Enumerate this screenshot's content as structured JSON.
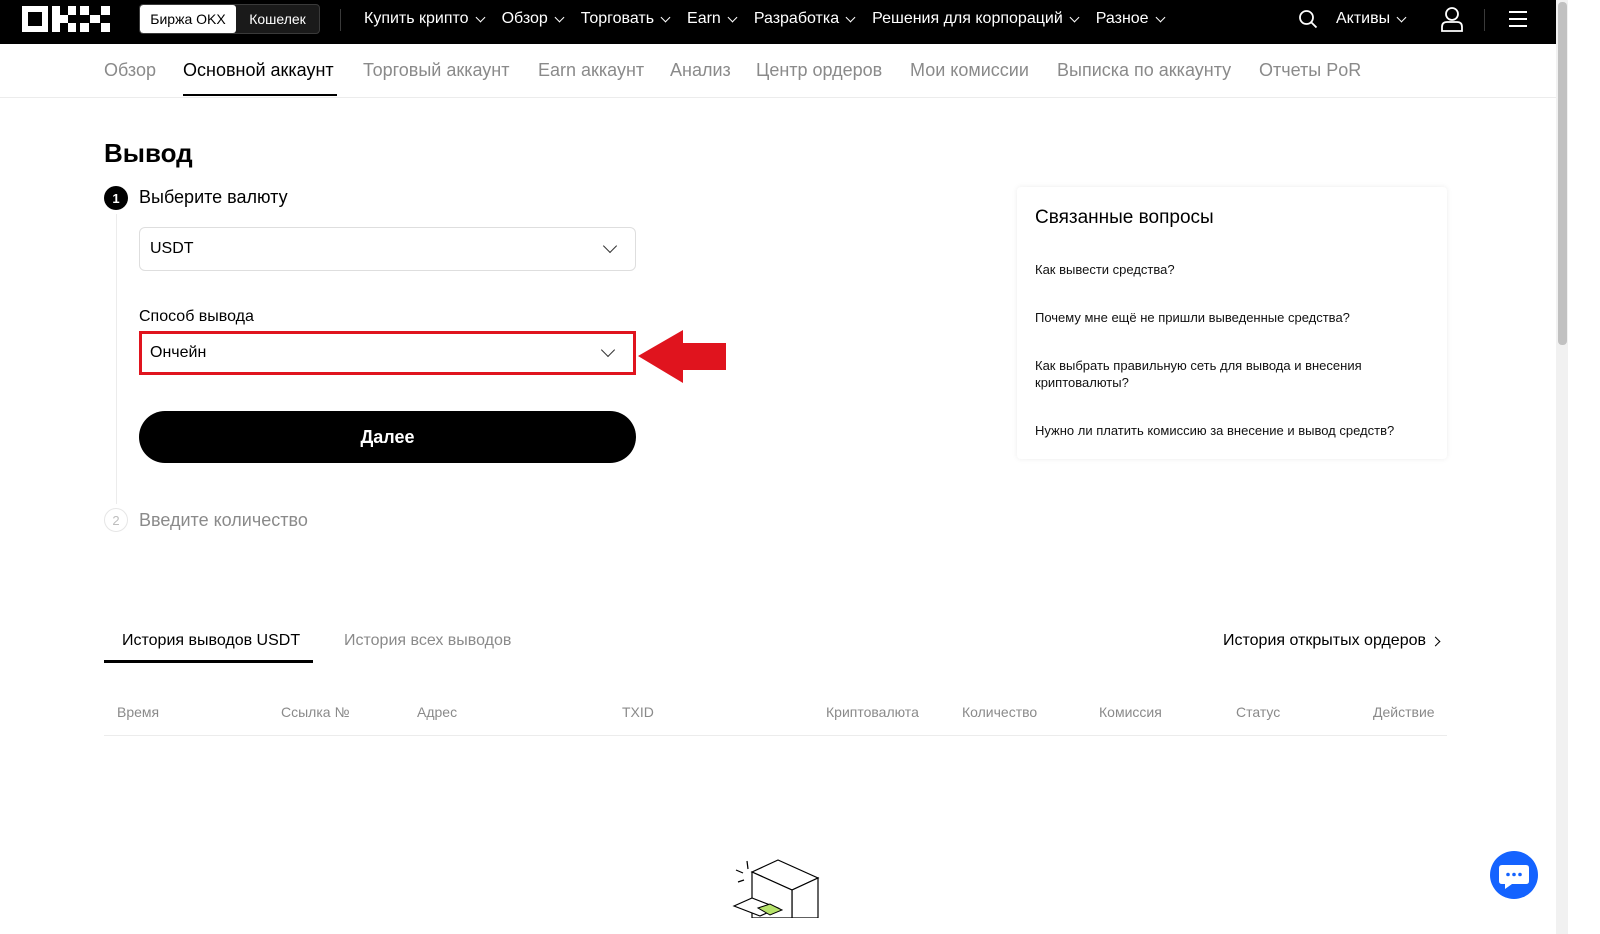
{
  "header": {
    "switch": {
      "exchange_label": "Биржа OKX",
      "wallet_label": "Кошелек"
    },
    "nav": [
      {
        "label": "Купить крипто"
      },
      {
        "label": "Обзор"
      },
      {
        "label": "Торговать"
      },
      {
        "label": "Earn"
      },
      {
        "label": "Разработка"
      },
      {
        "label": "Решения для корпораций"
      },
      {
        "label": "Разное"
      }
    ],
    "assets_label": "Активы"
  },
  "subnav": {
    "items": [
      {
        "label": "Обзор"
      },
      {
        "label": "Основной аккаунт"
      },
      {
        "label": "Торговый аккаунт"
      },
      {
        "label": "Earn аккаунт"
      },
      {
        "label": "Анализ"
      },
      {
        "label": "Центр ордеров"
      },
      {
        "label": "Мои комиссии"
      },
      {
        "label": "Выписка по аккаунту"
      },
      {
        "label": "Отчеты PoR"
      }
    ]
  },
  "withdraw": {
    "title": "Вывод",
    "step1": {
      "number": "1",
      "label": "Выберите валюту"
    },
    "currency_value": "USDT",
    "method_label": "Способ вывода",
    "method_value": "Ончейн",
    "next_label": "Далее",
    "step2": {
      "number": "2",
      "label": "Введите количество"
    }
  },
  "faq": {
    "title": "Связанные вопросы",
    "items": [
      "Как вывести средства?",
      "Почему мне ещё не пришли выведенные средства?",
      "Как выбрать правильную сеть для вывода и внесения криптовалюты?",
      "Нужно ли платить комиссию за внесение и вывод средств?"
    ]
  },
  "history": {
    "tab_active": "История выводов USDT",
    "tab_all": "История всех выводов",
    "open_orders_label": "История открытых ордеров",
    "columns": [
      "Время",
      "Ссылка №",
      "Адрес",
      "TXID",
      "Криптовалюта",
      "Количество",
      "Комиссия",
      "Статус",
      "Действие"
    ]
  },
  "colors": {
    "annotation_red": "#e0141e",
    "chat_blue": "#1463ff"
  }
}
